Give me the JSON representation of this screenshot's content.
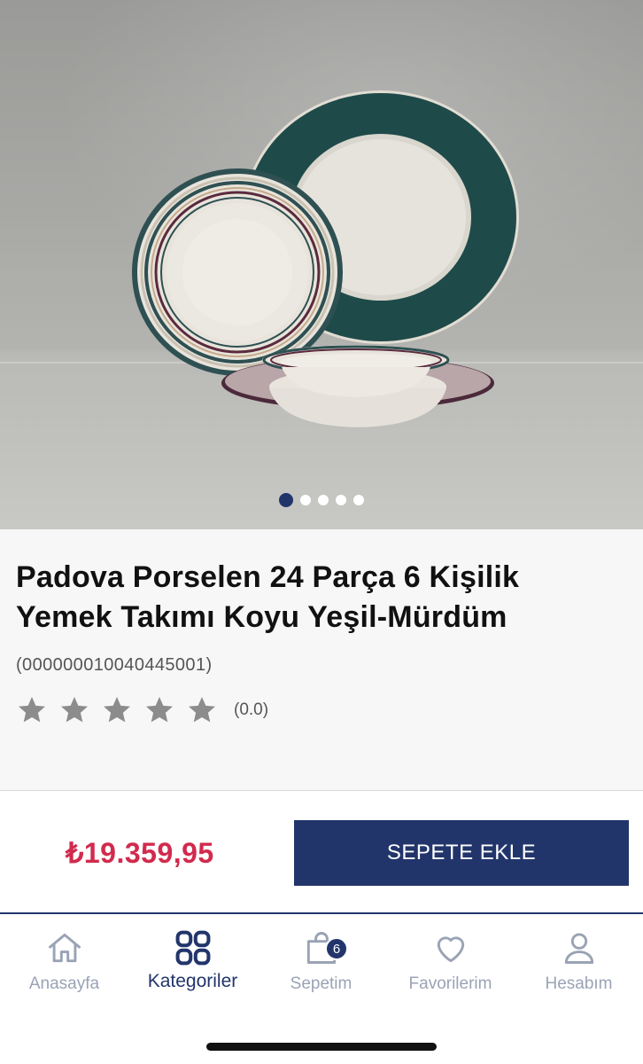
{
  "gallery": {
    "image_count": 5,
    "active_index": 0
  },
  "product": {
    "title_line1": "Padova Porselen 24 Parça 6 Kişilik",
    "title_line2": "Yemek Takımı Koyu Yeşil-Mürdüm",
    "code": "(000000010040445001)",
    "rating_value": 0,
    "rating_max": 5,
    "rating_text": "(0.0)"
  },
  "purchase": {
    "price": "₺19.359,95",
    "add_to_cart_label": "SEPETE EKLE"
  },
  "tabbar": {
    "home": "Anasayfa",
    "categories": "Kategoriler",
    "cart": "Sepetim",
    "cart_badge": "6",
    "favorites": "Favorilerim",
    "account": "Hesabım",
    "active_tab": "categories"
  },
  "colors": {
    "brand_navy": "#22356b",
    "price_red": "#d22a4d",
    "star_gray": "#8c8c8c",
    "tab_inactive": "#9aa3b5"
  },
  "icons": [
    "home-icon",
    "categories-icon",
    "cart-bag-icon",
    "heart-icon",
    "user-icon",
    "star-icon"
  ]
}
